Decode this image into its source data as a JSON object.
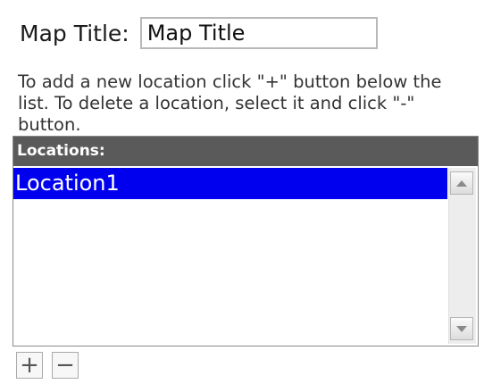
{
  "map_title": {
    "label": "Map Title:",
    "value": "Map Title"
  },
  "instructions": "To add a new location click \"+\" button below the list. To delete a location, select it and click \"-\" button.",
  "locations": {
    "header": "Locations:",
    "items": [
      {
        "label": "Location1",
        "selected": true
      }
    ]
  },
  "buttons": {
    "add_label": "+",
    "remove_label": "−"
  },
  "colors": {
    "selection": "#0000ee",
    "header_bg": "#5a5a5a"
  },
  "icons": {
    "scroll_up": "triangle-up-icon",
    "scroll_down": "triangle-down-icon"
  }
}
